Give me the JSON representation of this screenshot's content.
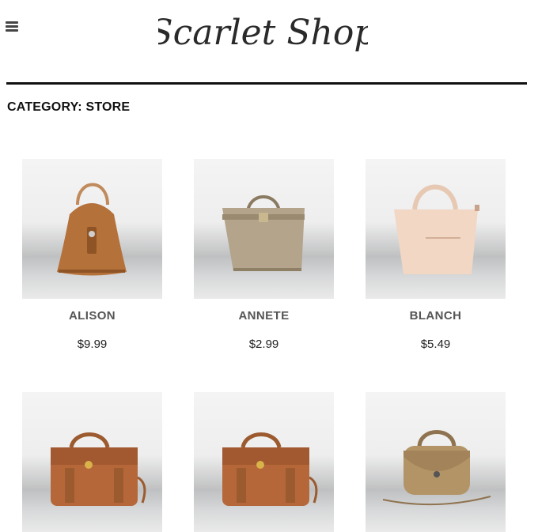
{
  "header": {
    "logo_text": "Scarlet Shop",
    "menu_icon": "hamburger-menu-icon"
  },
  "page": {
    "category_heading": "CATEGORY: STORE"
  },
  "products": [
    {
      "name": "ALISON",
      "price": "$9.99",
      "color": "#b5713a"
    },
    {
      "name": "ANNETE",
      "price": "$2.99",
      "color": "#b3a48b"
    },
    {
      "name": "BLANCH",
      "price": "$5.49",
      "color": "#f1d7c4"
    },
    {
      "color": "#b5673a"
    },
    {
      "color": "#b5673a"
    },
    {
      "color": "#b39467"
    }
  ]
}
